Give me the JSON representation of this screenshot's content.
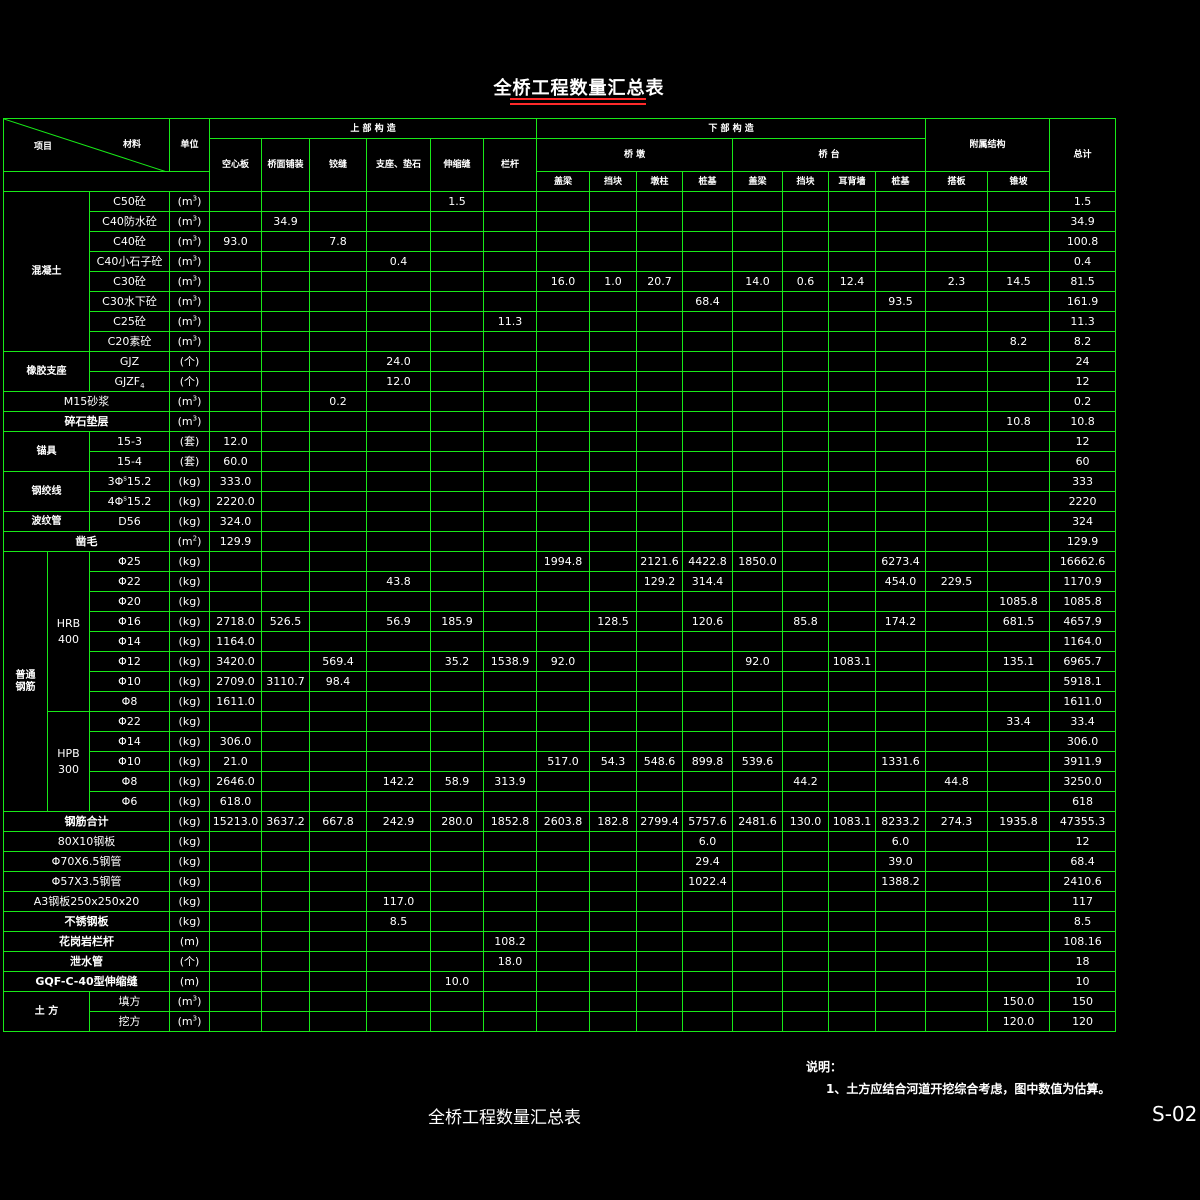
{
  "title": "全桥工程数量汇总表",
  "header": {
    "item": "项目",
    "material": "材料",
    "unit": "单位",
    "superstructure": "上 部 构 造",
    "substructure": "下 部 构 造",
    "ancillary": "附属结构",
    "total": "总计",
    "pier": "桥 墩",
    "abutment": "桥 台",
    "cols": [
      "空心板",
      "桥面铺装",
      "铰缝",
      "支座、垫石",
      "伸缩缝",
      "栏杆",
      "盖梁",
      "挡块",
      "墩柱",
      "桩基",
      "盖梁",
      "挡块",
      "耳背墙",
      "桩基",
      "搭板",
      "锥坡"
    ]
  },
  "groups": {
    "concrete": "混凝土",
    "rubber": "橡胶支座",
    "anchor": "锚具",
    "strand": "钢绞线",
    "duct": "波纹管",
    "rebar": "普通\n钢筋",
    "hrb": "HRB\n400",
    "hpb": "HPB\n300",
    "earth": "土 方"
  },
  "rows": [
    {
      "m": "C50砼",
      "u": "m3",
      "v": [
        "",
        "",
        "",
        "",
        "1.5",
        "",
        "",
        "",
        "",
        "",
        "",
        "",
        "",
        "",
        "",
        ""
      ],
      "t": "1.5"
    },
    {
      "m": "C40防水砼",
      "u": "m3",
      "v": [
        "",
        "34.9",
        "",
        "",
        "",
        "",
        "",
        "",
        "",
        "",
        "",
        "",
        "",
        "",
        "",
        ""
      ],
      "t": "34.9"
    },
    {
      "m": "C40砼",
      "u": "m3",
      "v": [
        "93.0",
        "",
        "7.8",
        "",
        "",
        "",
        "",
        "",
        "",
        "",
        "",
        "",
        "",
        "",
        "",
        ""
      ],
      "t": "100.8"
    },
    {
      "m": "C40小石子砼",
      "u": "m3",
      "v": [
        "",
        "",
        "",
        "0.4",
        "",
        "",
        "",
        "",
        "",
        "",
        "",
        "",
        "",
        "",
        "",
        ""
      ],
      "t": "0.4"
    },
    {
      "m": "C30砼",
      "u": "m3",
      "v": [
        "",
        "",
        "",
        "",
        "",
        "",
        "16.0",
        "1.0",
        "20.7",
        "",
        "14.0",
        "0.6",
        "12.4",
        "",
        "2.3",
        "14.5"
      ],
      "t": "81.5"
    },
    {
      "m": "C30水下砼",
      "u": "m3",
      "v": [
        "",
        "",
        "",
        "",
        "",
        "",
        "",
        "",
        "",
        "68.4",
        "",
        "",
        "",
        "93.5",
        "",
        ""
      ],
      "t": "161.9"
    },
    {
      "m": "C25砼",
      "u": "m3",
      "v": [
        "",
        "",
        "",
        "",
        "",
        "11.3",
        "",
        "",
        "",
        "",
        "",
        "",
        "",
        "",
        "",
        ""
      ],
      "t": "11.3"
    },
    {
      "m": "C20素砼",
      "u": "m3",
      "v": [
        "",
        "",
        "",
        "",
        "",
        "",
        "",
        "",
        "",
        "",
        "",
        "",
        "",
        "",
        "",
        "8.2"
      ],
      "t": "8.2"
    },
    {
      "m": "GJZ",
      "u": "个",
      "v": [
        "",
        "",
        "",
        "24.0",
        "",
        "",
        "",
        "",
        "",
        "",
        "",
        "",
        "",
        "",
        "",
        ""
      ],
      "t": "24"
    },
    {
      "m": "GJZF4",
      "u": "个",
      "v": [
        "",
        "",
        "",
        "12.0",
        "",
        "",
        "",
        "",
        "",
        "",
        "",
        "",
        "",
        "",
        "",
        ""
      ],
      "t": "12"
    },
    {
      "m": "M15砂浆",
      "u": "m3",
      "v": [
        "",
        "",
        "0.2",
        "",
        "",
        "",
        "",
        "",
        "",
        "",
        "",
        "",
        "",
        "",
        "",
        ""
      ],
      "t": "0.2"
    },
    {
      "m": "碎石垫层",
      "u": "m3",
      "v": [
        "",
        "",
        "",
        "",
        "",
        "",
        "",
        "",
        "",
        "",
        "",
        "",
        "",
        "",
        "",
        "10.8"
      ],
      "t": "10.8"
    },
    {
      "m": "15-3",
      "u": "套",
      "v": [
        "12.0",
        "",
        "",
        "",
        "",
        "",
        "",
        "",
        "",
        "",
        "",
        "",
        "",
        "",
        "",
        ""
      ],
      "t": "12"
    },
    {
      "m": "15-4",
      "u": "套",
      "v": [
        "60.0",
        "",
        "",
        "",
        "",
        "",
        "",
        "",
        "",
        "",
        "",
        "",
        "",
        "",
        "",
        ""
      ],
      "t": "60"
    },
    {
      "m": "3Φs15.2",
      "u": "kg",
      "v": [
        "333.0",
        "",
        "",
        "",
        "",
        "",
        "",
        "",
        "",
        "",
        "",
        "",
        "",
        "",
        "",
        ""
      ],
      "t": "333"
    },
    {
      "m": "4Φs15.2",
      "u": "kg",
      "v": [
        "2220.0",
        "",
        "",
        "",
        "",
        "",
        "",
        "",
        "",
        "",
        "",
        "",
        "",
        "",
        "",
        ""
      ],
      "t": "2220"
    },
    {
      "m": "D56",
      "u": "kg",
      "v": [
        "324.0",
        "",
        "",
        "",
        "",
        "",
        "",
        "",
        "",
        "",
        "",
        "",
        "",
        "",
        "",
        ""
      ],
      "t": "324"
    },
    {
      "m": "凿毛",
      "u": "m2",
      "v": [
        "129.9",
        "",
        "",
        "",
        "",
        "",
        "",
        "",
        "",
        "",
        "",
        "",
        "",
        "",
        "",
        ""
      ],
      "t": "129.9"
    },
    {
      "m": "Φ25",
      "u": "kg",
      "v": [
        "",
        "",
        "",
        "",
        "",
        "",
        "1994.8",
        "",
        "2121.6",
        "4422.8",
        "1850.0",
        "",
        "",
        "6273.4",
        "",
        ""
      ],
      "t": "16662.6"
    },
    {
      "m": "Φ22",
      "u": "kg",
      "v": [
        "",
        "",
        "",
        "43.8",
        "",
        "",
        "",
        "",
        "129.2",
        "314.4",
        "",
        "",
        "",
        "454.0",
        "229.5",
        ""
      ],
      "t": "1170.9"
    },
    {
      "m": "Φ20",
      "u": "kg",
      "v": [
        "",
        "",
        "",
        "",
        "",
        "",
        "",
        "",
        "",
        "",
        "",
        "",
        "",
        "",
        "",
        "1085.8"
      ],
      "t": "1085.8"
    },
    {
      "m": "Φ16",
      "u": "kg",
      "v": [
        "2718.0",
        "526.5",
        "",
        "56.9",
        "185.9",
        "",
        "",
        "128.5",
        "",
        "120.6",
        "",
        "85.8",
        "",
        "174.2",
        "",
        "681.5"
      ],
      "t": "4657.9"
    },
    {
      "m": "Φ14",
      "u": "kg",
      "v": [
        "1164.0",
        "",
        "",
        "",
        "",
        "",
        "",
        "",
        "",
        "",
        "",
        "",
        "",
        "",
        "",
        ""
      ],
      "t": "1164.0"
    },
    {
      "m": "Φ12",
      "u": "kg",
      "v": [
        "3420.0",
        "",
        "569.4",
        "",
        "35.2",
        "1538.9",
        "92.0",
        "",
        "",
        "",
        "92.0",
        "",
        "1083.1",
        "",
        "",
        "135.1"
      ],
      "t": "6965.7"
    },
    {
      "m": "Φ10",
      "u": "kg",
      "v": [
        "2709.0",
        "3110.7",
        "98.4",
        "",
        "",
        "",
        "",
        "",
        "",
        "",
        "",
        "",
        "",
        "",
        "",
        ""
      ],
      "t": "5918.1"
    },
    {
      "m": "Φ8",
      "u": "kg",
      "v": [
        "1611.0",
        "",
        "",
        "",
        "",
        "",
        "",
        "",
        "",
        "",
        "",
        "",
        "",
        "",
        "",
        ""
      ],
      "t": "1611.0"
    },
    {
      "m": "Φ22",
      "u": "kg",
      "v": [
        "",
        "",
        "",
        "",
        "",
        "",
        "",
        "",
        "",
        "",
        "",
        "",
        "",
        "",
        "",
        "33.4"
      ],
      "t": "33.4"
    },
    {
      "m": "Φ14",
      "u": "kg",
      "v": [
        "306.0",
        "",
        "",
        "",
        "",
        "",
        "",
        "",
        "",
        "",
        "",
        "",
        "",
        "",
        "",
        ""
      ],
      "t": "306.0"
    },
    {
      "m": "Φ10",
      "u": "kg",
      "v": [
        "21.0",
        "",
        "",
        "",
        "",
        "",
        "517.0",
        "54.3",
        "548.6",
        "899.8",
        "539.6",
        "",
        "",
        "1331.6",
        "",
        ""
      ],
      "t": "3911.9"
    },
    {
      "m": "Φ8",
      "u": "kg",
      "v": [
        "2646.0",
        "",
        "",
        "142.2",
        "58.9",
        "313.9",
        "",
        "",
        "",
        "",
        "",
        "44.2",
        "",
        "",
        "44.8",
        ""
      ],
      "t": "3250.0"
    },
    {
      "m": "Φ6",
      "u": "kg",
      "v": [
        "618.0",
        "",
        "",
        "",
        "",
        "",
        "",
        "",
        "",
        "",
        "",
        "",
        "",
        "",
        "",
        ""
      ],
      "t": "618"
    },
    {
      "m": "钢筋合计",
      "u": "kg",
      "v": [
        "15213.0",
        "3637.2",
        "667.8",
        "242.9",
        "280.0",
        "1852.8",
        "2603.8",
        "182.8",
        "2799.4",
        "5757.6",
        "2481.6",
        "130.0",
        "1083.1",
        "8233.2",
        "274.3",
        "1935.8"
      ],
      "t": "47355.3"
    },
    {
      "m": "80X10钢板",
      "u": "kg",
      "v": [
        "",
        "",
        "",
        "",
        "",
        "",
        "",
        "",
        "",
        "6.0",
        "",
        "",
        "",
        "6.0",
        "",
        ""
      ],
      "t": "12"
    },
    {
      "m": "Φ70X6.5钢管",
      "u": "kg",
      "v": [
        "",
        "",
        "",
        "",
        "",
        "",
        "",
        "",
        "",
        "29.4",
        "",
        "",
        "",
        "39.0",
        "",
        ""
      ],
      "t": "68.4"
    },
    {
      "m": "Φ57X3.5钢管",
      "u": "kg",
      "v": [
        "",
        "",
        "",
        "",
        "",
        "",
        "",
        "",
        "",
        "1022.4",
        "",
        "",
        "",
        "1388.2",
        "",
        ""
      ],
      "t": "2410.6"
    },
    {
      "m": "A3钢板250x250x20",
      "u": "kg",
      "v": [
        "",
        "",
        "",
        "117.0",
        "",
        "",
        "",
        "",
        "",
        "",
        "",
        "",
        "",
        "",
        "",
        ""
      ],
      "t": "117"
    },
    {
      "m": "不锈钢板",
      "u": "kg",
      "v": [
        "",
        "",
        "",
        "8.5",
        "",
        "",
        "",
        "",
        "",
        "",
        "",
        "",
        "",
        "",
        "",
        ""
      ],
      "t": "8.5"
    },
    {
      "m": "花岗岩栏杆",
      "u": "m",
      "v": [
        "",
        "",
        "",
        "",
        "",
        "108.2",
        "",
        "",
        "",
        "",
        "",
        "",
        "",
        "",
        "",
        ""
      ],
      "t": "108.16"
    },
    {
      "m": "泄水管",
      "u": "个",
      "v": [
        "",
        "",
        "",
        "",
        "",
        "18.0",
        "",
        "",
        "",
        "",
        "",
        "",
        "",
        "",
        "",
        ""
      ],
      "t": "18"
    },
    {
      "m": "GQF-C-40型伸缩缝",
      "u": "m",
      "v": [
        "",
        "",
        "",
        "",
        "10.0",
        "",
        "",
        "",
        "",
        "",
        "",
        "",
        "",
        "",
        "",
        ""
      ],
      "t": "10"
    },
    {
      "m": "填方",
      "u": "m3",
      "v": [
        "",
        "",
        "",
        "",
        "",
        "",
        "",
        "",
        "",
        "",
        "",
        "",
        "",
        "",
        "",
        "150.0"
      ],
      "t": "150"
    },
    {
      "m": "挖方",
      "u": "m3",
      "v": [
        "",
        "",
        "",
        "",
        "",
        "",
        "",
        "",
        "",
        "",
        "",
        "",
        "",
        "",
        "",
        "120.0"
      ],
      "t": "120"
    }
  ],
  "note_heading": "说明：",
  "note_1": "1、土方应结合河道开挖综合考虑，图中数值为估算。",
  "footer_title": "全桥工程数量汇总表",
  "drawing_no": "S-02",
  "colors": {
    "grid": "#18e818",
    "border": "#ff3030",
    "text": "#ffffff",
    "bg": "#000000",
    "underline": "#ff2a2a"
  }
}
